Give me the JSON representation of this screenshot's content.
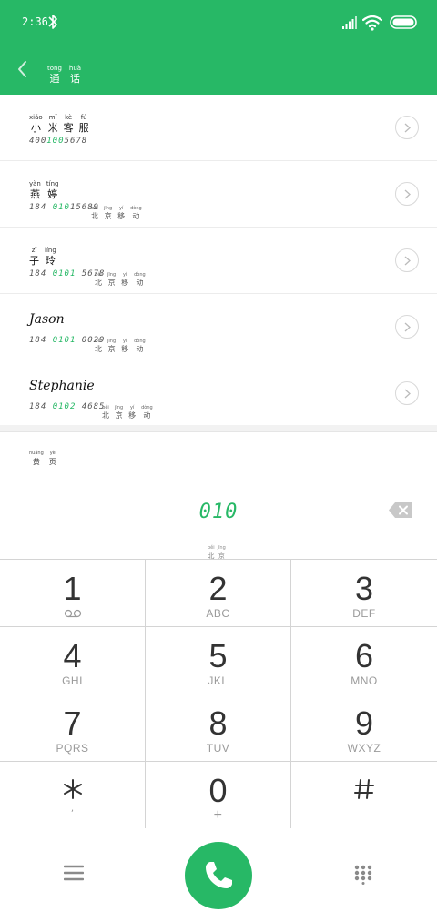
{
  "status": {
    "time": "2:36",
    "icons": [
      "bluetooth-icon",
      "signal-icon",
      "wifi-icon",
      "battery-icon"
    ]
  },
  "header": {
    "title": [
      {
        "py": "tōng",
        "hz": "通"
      },
      {
        "py": "huà",
        "hz": "话"
      }
    ]
  },
  "contacts": [
    {
      "name_ruby": [
        {
          "py": "xiǎo",
          "hz": "小"
        },
        {
          "py": "mǐ",
          "hz": "米"
        },
        {
          "py": "kè",
          "hz": "客"
        },
        {
          "py": "fú",
          "hz": "服"
        }
      ],
      "num_pre": "400",
      "num_hl": "100",
      "num_post": "5678",
      "loc": []
    },
    {
      "name_ruby": [
        {
          "py": "yàn",
          "hz": "燕"
        },
        {
          "py": "tíng",
          "hz": "婷"
        }
      ],
      "num_pre": "184 ",
      "num_hl": "010",
      "num_post": "15689",
      "loc": [
        {
          "py": "běi",
          "hz": "北"
        },
        {
          "py": "jīng",
          "hz": "京"
        },
        {
          "py": "yí",
          "hz": "移"
        },
        {
          "py": "dòng",
          "hz": "动"
        }
      ]
    },
    {
      "name_ruby": [
        {
          "py": "zǐ",
          "hz": "子"
        },
        {
          "py": "líng",
          "hz": "玲"
        }
      ],
      "num_pre": "184 ",
      "num_hl": "0101",
      "num_post": " 5678",
      "loc": [
        {
          "py": "běi",
          "hz": "北"
        },
        {
          "py": "jīng",
          "hz": "京"
        },
        {
          "py": "yí",
          "hz": "移"
        },
        {
          "py": "dòng",
          "hz": "动"
        }
      ]
    },
    {
      "name_latin": "Jason",
      "num_pre": "184 ",
      "num_hl": "0101",
      "num_post": " 0029",
      "loc": [
        {
          "py": "běi",
          "hz": "北"
        },
        {
          "py": "jīng",
          "hz": "京"
        },
        {
          "py": "yí",
          "hz": "移"
        },
        {
          "py": "dòng",
          "hz": "动"
        }
      ]
    },
    {
      "name_latin": "Stephanie",
      "num_pre": "184 ",
      "num_hl": "0102",
      "num_post": " 4685",
      "loc": [
        {
          "py": "běi",
          "hz": "北"
        },
        {
          "py": "jīng",
          "hz": "京"
        },
        {
          "py": "yí",
          "hz": "移"
        },
        {
          "py": "dòng",
          "hz": "动"
        }
      ]
    }
  ],
  "extra_row": [
    {
      "py": "huáng",
      "hz": "黄"
    },
    {
      "py": "yè",
      "hz": "页"
    }
  ],
  "dialer": {
    "digits": "010",
    "loc": [
      {
        "py": "běi",
        "hz": "北"
      },
      {
        "py": "jīng",
        "hz": "京"
      }
    ]
  },
  "keys": [
    {
      "d": "1",
      "l": ""
    },
    {
      "d": "2",
      "l": "ABC"
    },
    {
      "d": "3",
      "l": "DEF"
    },
    {
      "d": "4",
      "l": "GHI"
    },
    {
      "d": "5",
      "l": "JKL"
    },
    {
      "d": "6",
      "l": "MNO"
    },
    {
      "d": "7",
      "l": "PQRS"
    },
    {
      "d": "8",
      "l": "TUV"
    },
    {
      "d": "9",
      "l": "WXYZ"
    },
    {
      "d": "",
      "l": ","
    },
    {
      "d": "0",
      "l": "+"
    },
    {
      "d": "",
      "l": ""
    }
  ],
  "colors": {
    "accent": "#27b866",
    "divider": "#d4d4d4"
  }
}
